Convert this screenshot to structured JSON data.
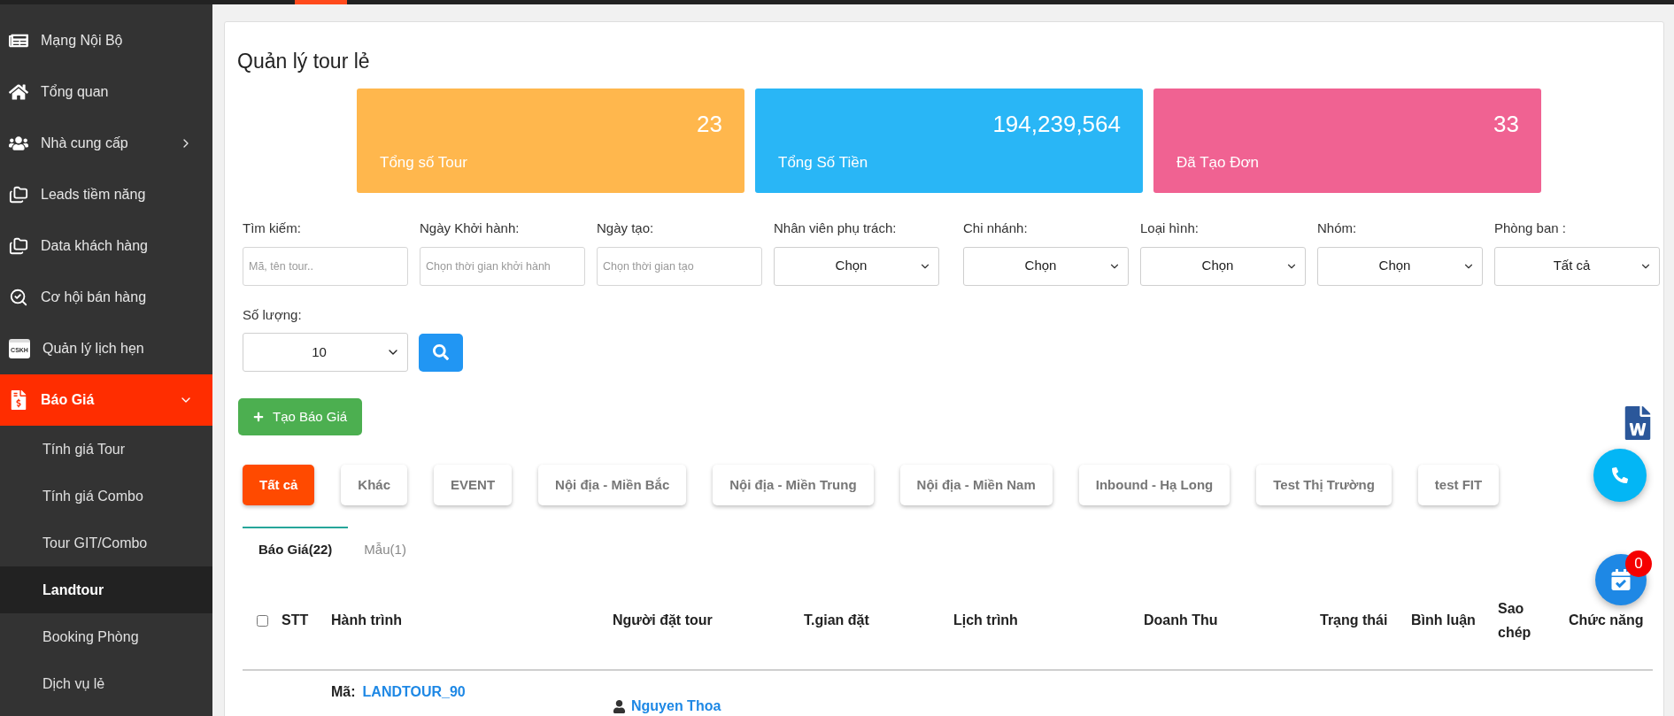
{
  "sidebar": {
    "items": [
      {
        "label": "Mạng Nội Bộ",
        "selected": false
      },
      {
        "label": "Tổng quan",
        "selected": false
      },
      {
        "label": "Nhà cung cấp",
        "selected": false,
        "expanded": false
      },
      {
        "label": "Leads tiềm năng",
        "selected": false
      },
      {
        "label": "Data khách hàng",
        "selected": false
      },
      {
        "label": "Cơ hội bán hàng",
        "selected": false
      },
      {
        "label": "Quản lý lịch hẹn",
        "selected": false,
        "icon_text": "CSKH"
      },
      {
        "label": "Báo Giá",
        "selected": true,
        "expanded": true,
        "children": [
          {
            "label": "Tính giá Tour",
            "selected": false
          },
          {
            "label": "Tính giá Combo",
            "selected": false
          },
          {
            "label": "Tour GIT/Combo",
            "selected": false
          },
          {
            "label": "Landtour",
            "selected": true
          },
          {
            "label": "Booking Phòng",
            "selected": false
          },
          {
            "label": "Dịch vụ lẻ",
            "selected": false
          }
        ]
      }
    ]
  },
  "page": {
    "title": "Quản lý tour lẻ"
  },
  "stats": [
    {
      "label": "Tổng số Tour",
      "value": "23",
      "color": "#ffb74d"
    },
    {
      "label": "Tổng Số Tiền",
      "value": "194,239,564",
      "color": "#29b6f6"
    },
    {
      "label": "Đã Tạo Đơn",
      "value": "33",
      "color": "#f06292"
    }
  ],
  "filters": [
    {
      "label": "Tìm kiếm:",
      "kind": "text",
      "placeholder": "Mã, tên tour.."
    },
    {
      "label": "Ngày Khởi hành:",
      "kind": "text",
      "placeholder": "Chọn thời gian khởi hành"
    },
    {
      "label": "Ngày tạo:",
      "kind": "text",
      "placeholder": "Chọn thời gian tạo"
    },
    {
      "label": "Nhân viên phụ trách:",
      "kind": "select",
      "value": "Chọn"
    },
    {
      "label": "Chi nhánh:",
      "kind": "select",
      "value": "Chọn"
    },
    {
      "label": "Loại hình:",
      "kind": "select",
      "value": "Chọn"
    },
    {
      "label": "Nhóm:",
      "kind": "select",
      "value": "Chọn"
    },
    {
      "label": "Phòng ban :",
      "kind": "select",
      "value": "Tất cả"
    }
  ],
  "count": {
    "label": "Số lượng:",
    "value": "10"
  },
  "create_button": "Tạo Báo Giá",
  "categories": [
    {
      "label": "Tất cả",
      "selected": true
    },
    {
      "label": "Khác",
      "selected": false
    },
    {
      "label": "EVENT",
      "selected": false
    },
    {
      "label": "Nội địa - Miền Bắc",
      "selected": false
    },
    {
      "label": "Nội địa - Miền Trung",
      "selected": false
    },
    {
      "label": "Nội địa - Miền Nam",
      "selected": false
    },
    {
      "label": "Inbound - Hạ Long",
      "selected": false
    },
    {
      "label": "Test Thị Trường",
      "selected": false
    },
    {
      "label": "test FIT",
      "selected": false
    }
  ],
  "tabs": [
    {
      "label": "Báo Giá(22)",
      "selected": true
    },
    {
      "label": "Mẫu(1)",
      "selected": false
    }
  ],
  "table": {
    "select_all_checked": false,
    "columns": [
      "STT",
      "Hành trình",
      "Người đặt tour",
      "T.gian đặt",
      "Lịch trình",
      "Doanh Thu",
      "Trạng thái",
      "Bình luận",
      "Sao chép",
      "Chức năng"
    ],
    "rows": [
      {
        "code_label": "Mã:",
        "code": "LANDTOUR_90",
        "booker": "Nguyen Thoa"
      }
    ]
  },
  "calendar_badge": "0"
}
